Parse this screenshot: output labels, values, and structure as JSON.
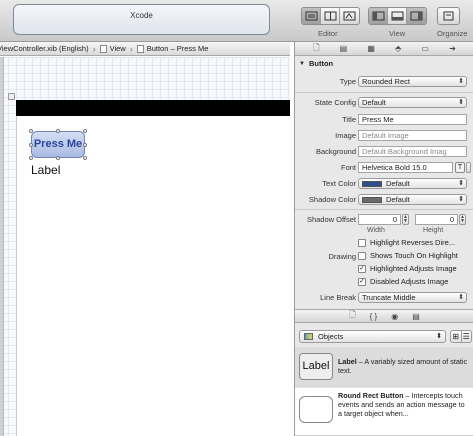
{
  "toolbar": {
    "activity_title": "Xcode",
    "editor_label": "Editor",
    "view_label": "View",
    "organizer_label": "Organize"
  },
  "jumpbar": {
    "file": "ViewController.xib (English)",
    "crumb2": "View",
    "crumb3": "Button – Press Me"
  },
  "canvas": {
    "button_title": "Press Me",
    "label_text": "Label"
  },
  "inspector": {
    "section_title": "Button",
    "type": {
      "label": "Type",
      "value": "Rounded Rect"
    },
    "state_config": {
      "label": "State Config",
      "value": "Default"
    },
    "title": {
      "label": "Title",
      "value": "Press Me"
    },
    "image": {
      "label": "Image",
      "placeholder": "Default Image"
    },
    "background": {
      "label": "Background",
      "placeholder": "Default Background Imag"
    },
    "font": {
      "label": "Font",
      "value": "Helvetica Bold 15.0"
    },
    "text_color": {
      "label": "Text Color",
      "value": "Default",
      "swatch": "#2f4f8f"
    },
    "shadow_color": {
      "label": "Shadow Color",
      "value": "Default",
      "swatch": "#6b6b6b"
    },
    "shadow_offset": {
      "label": "Shadow Offset",
      "width": "0",
      "height": "0",
      "width_label": "Width",
      "height_label": "Height"
    },
    "highlight_reverses": "Highlight Reverses Dire...",
    "drawing_label": "Drawing",
    "shows_touch": "Shows Touch On Highlight",
    "highlighted_adjusts": "Highlighted Adjusts Image",
    "disabled_adjusts": "Disabled Adjusts Image",
    "line_break": {
      "label": "Line Break",
      "value": "Truncate Middle"
    }
  },
  "library": {
    "popup": "Objects",
    "items": [
      {
        "thumb": "Label",
        "name": "Label",
        "desc": " – A variably sized amount of static text."
      },
      {
        "thumb": "",
        "name": "Round Rect Button",
        "desc": " – Intercepts touch events and sends an action message to a target object when..."
      }
    ]
  }
}
